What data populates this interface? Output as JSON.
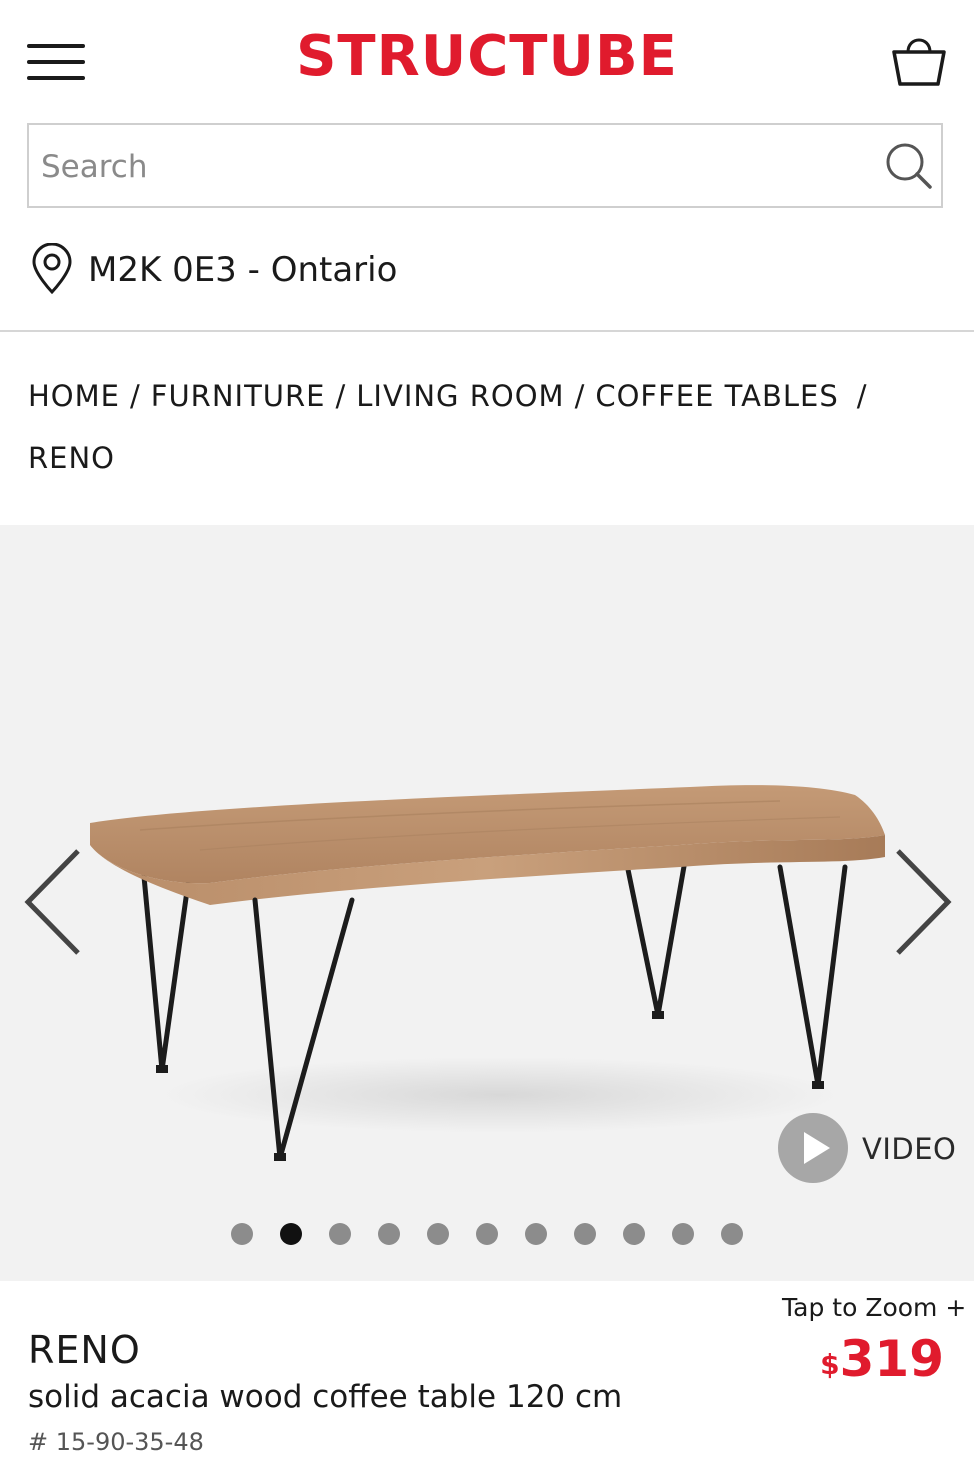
{
  "header": {
    "brand": "STRUCTUBE",
    "brand_color": "#e01b2d",
    "menu_icon": "hamburger-menu-icon",
    "cart_icon": "shopping-bag-icon"
  },
  "search": {
    "placeholder": "Search",
    "value": "",
    "icon": "search-icon"
  },
  "location": {
    "icon": "location-pin-icon",
    "label": "M2K 0E3 - Ontario"
  },
  "breadcrumb": {
    "items": [
      "HOME",
      "FURNITURE",
      "LIVING ROOM",
      "COFFEE TABLES",
      "RENO"
    ],
    "separator": "/"
  },
  "gallery": {
    "image_alt": "RENO solid acacia wood coffee table",
    "prev_icon": "chevron-left-icon",
    "next_icon": "chevron-right-icon",
    "video_label": "VIDEO",
    "video_icon": "play-icon",
    "total_images": 11,
    "active_index": 1
  },
  "product": {
    "tap_to_zoom": "Tap to Zoom +",
    "currency_symbol": "$",
    "price": "319",
    "price_color": "#e01b2d",
    "name": "RENO",
    "description": "solid acacia wood coffee table 120 cm",
    "sku": "# 15-90-35-48"
  }
}
